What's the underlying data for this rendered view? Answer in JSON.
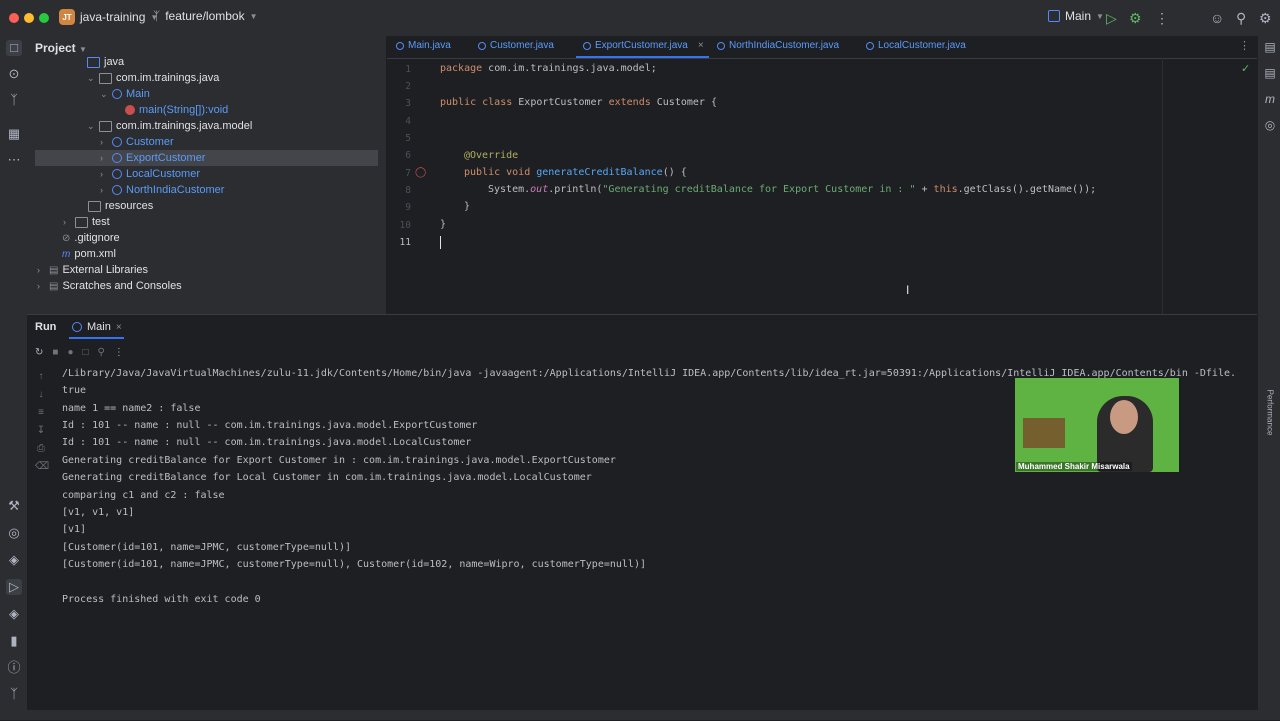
{
  "titlebar": {
    "project_badge": "JT",
    "project_name": "java-training",
    "branch": "feature/lombok",
    "run_config": "Main",
    "colors": {
      "close": "#ff5f57",
      "minimize": "#febc2e",
      "zoom": "#28c840"
    }
  },
  "project_panel": {
    "title": "Project",
    "rows": [
      {
        "label": "java",
        "type": "folder"
      },
      {
        "label": "com.im.trainings.java",
        "type": "package"
      },
      {
        "label": "Main",
        "type": "class"
      },
      {
        "label": "main(String[]):void",
        "type": "method"
      },
      {
        "label": "com.im.trainings.java.model",
        "type": "package"
      },
      {
        "label": "Customer",
        "type": "class"
      },
      {
        "label": "ExportCustomer",
        "type": "class"
      },
      {
        "label": "LocalCustomer",
        "type": "class"
      },
      {
        "label": "NorthIndiaCustomer",
        "type": "class"
      },
      {
        "label": "resources",
        "type": "folder"
      },
      {
        "label": "test",
        "type": "folder"
      },
      {
        "label": ".gitignore",
        "type": "file"
      },
      {
        "label": "pom.xml",
        "type": "file"
      },
      {
        "label": "External Libraries",
        "type": "lib"
      },
      {
        "label": "Scratches and Consoles",
        "type": "lib"
      }
    ]
  },
  "editor": {
    "tabs": [
      "Main.java",
      "Customer.java",
      "ExportCustomer.java",
      "NorthIndiaCustomer.java",
      "LocalCustomer.java"
    ],
    "active_tab": "ExportCustomer.java",
    "line_numbers": [
      "1",
      "2",
      "3",
      "4",
      "5",
      "6",
      "7",
      "8",
      "9",
      "10",
      "11"
    ],
    "code": {
      "l1_kw": "package ",
      "l1_rest": "com.im.trainings.java.model;",
      "l3_kw1": "public class ",
      "l3_name": "ExportCustomer ",
      "l3_kw2": "extends ",
      "l3_rest": "Customer {",
      "l6_ann": "@Override",
      "l7_kw": "public void ",
      "l7_fn": "generateCreditBalance",
      "l7_rest": "() {",
      "l8_a": "System.",
      "l8_fld": "out",
      "l8_b": ".println(",
      "l8_str": "\"Generating creditBalance for Export Customer in : \"",
      "l8_c": " + ",
      "l8_kw": "this",
      "l8_d": ".getClass().getName());",
      "l9": "}",
      "l10": "}"
    }
  },
  "run_panel": {
    "title": "Run",
    "tab": "Main",
    "lines": [
      "/Library/Java/JavaVirtualMachines/zulu-11.jdk/Contents/Home/bin/java -javaagent:/Applications/IntelliJ IDEA.app/Contents/lib/idea_rt.jar=50391:/Applications/IntelliJ IDEA.app/Contents/bin -Dfile.",
      "true",
      "name 1 == name2 : false",
      "Id : 101 -- name : null -- com.im.trainings.java.model.ExportCustomer",
      "Id : 101 -- name : null -- com.im.trainings.java.model.LocalCustomer",
      "Generating creditBalance for Export Customer in : com.im.trainings.java.model.ExportCustomer",
      "Generating creditBalance for Local Customer in com.im.trainings.java.model.LocalCustomer",
      "comparing c1 and c2 : false",
      "[v1, v1, v1]",
      "[v1]",
      "[Customer(id=101, name=JPMC, customerType=null)]",
      "[Customer(id=101, name=JPMC, customerType=null), Customer(id=102, name=Wipro, customerType=null)]",
      "",
      "Process finished with exit code 0"
    ]
  },
  "video_overlay": {
    "caption": "Muhammed Shakir Misarwala"
  },
  "right_strip": {
    "performance_label": "Performance"
  }
}
